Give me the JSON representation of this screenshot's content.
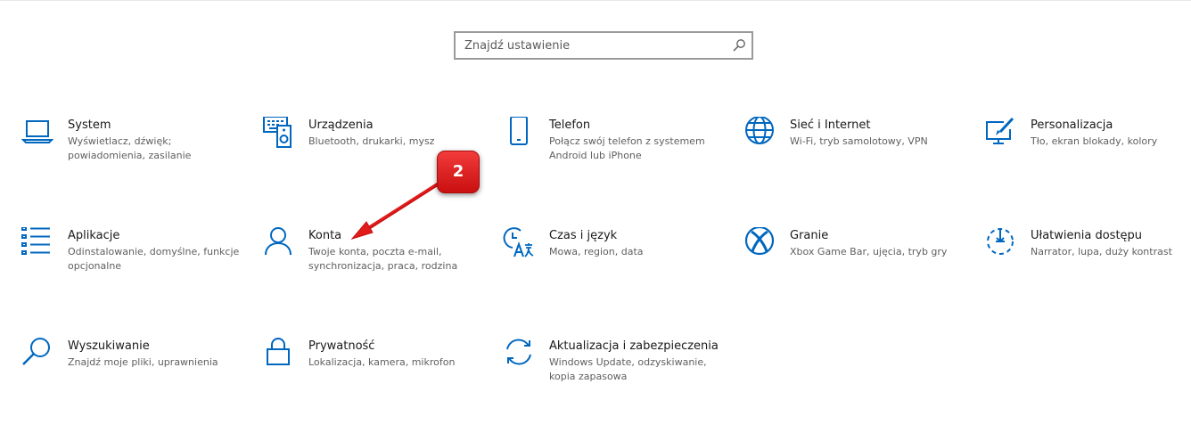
{
  "search": {
    "placeholder": "Znajdź ustawienie",
    "value": ""
  },
  "accent_color": "#0067c0",
  "annotation": {
    "badge_label": "2",
    "color": "#e21b1b"
  },
  "tiles": [
    {
      "title": "System",
      "desc": "Wyświetlacz, dźwięk; powiadomienia, zasilanie",
      "icon": "laptop-icon"
    },
    {
      "title": "Urządzenia",
      "desc": "Bluetooth, drukarki, mysz",
      "icon": "devices-icon"
    },
    {
      "title": "Telefon",
      "desc": "Połącz swój telefon z systemem Android lub iPhone",
      "icon": "phone-icon"
    },
    {
      "title": "Sieć i Internet",
      "desc": "Wi-Fi, tryb samolotowy, VPN",
      "icon": "globe-icon"
    },
    {
      "title": "Personalizacja",
      "desc": "Tło, ekran blokady, kolory",
      "icon": "personalization-icon"
    },
    {
      "title": "Aplikacje",
      "desc": "Odinstalowanie, domyślne, funkcje opcjonalne",
      "icon": "apps-list-icon"
    },
    {
      "title": "Konta",
      "desc": "Twoje konta, poczta e-mail, synchronizacja, praca, rodzina",
      "icon": "person-icon"
    },
    {
      "title": "Czas i język",
      "desc": "Mowa, region, data",
      "icon": "time-language-icon"
    },
    {
      "title": "Granie",
      "desc": "Xbox Game Bar, ujęcia, tryb gry",
      "icon": "xbox-icon"
    },
    {
      "title": "Ułatwienia dostępu",
      "desc": "Narrator, lupa, duży kontrast",
      "icon": "accessibility-icon"
    },
    {
      "title": "Wyszukiwanie",
      "desc": "Znajdź moje pliki, uprawnienia",
      "icon": "search-icon"
    },
    {
      "title": "Prywatność",
      "desc": "Lokalizacja, kamera, mikrofon",
      "icon": "lock-icon"
    },
    {
      "title": "Aktualizacja i zabezpieczenia",
      "desc": "Windows Update, odzyskiwanie, kopia zapasowa",
      "icon": "update-icon"
    }
  ]
}
